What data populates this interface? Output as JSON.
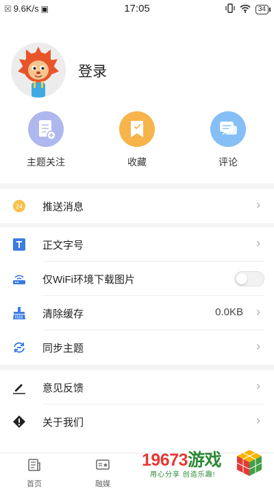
{
  "status_bar": {
    "speed": "9.6K/s",
    "time": "17:05",
    "battery": "34"
  },
  "profile": {
    "login_label": "登录"
  },
  "quick_actions": [
    {
      "label": "主题关注",
      "icon": "topic-follow-icon",
      "color": "#aeb8ee"
    },
    {
      "label": "收藏",
      "icon": "favorite-icon",
      "color": "#f7b44a"
    },
    {
      "label": "评论",
      "icon": "comment-icon",
      "color": "#86bff5"
    }
  ],
  "settings": {
    "push": {
      "label": "推送消息",
      "icon": "push-notification-icon"
    },
    "font_size": {
      "label": "正文字号",
      "icon": "font-size-icon"
    },
    "wifi_images": {
      "label": "仅WiFi环境下载图片",
      "icon": "wifi-router-icon",
      "enabled": false
    },
    "clear_cache": {
      "label": "清除缓存",
      "value": "0.0KB",
      "icon": "broom-icon"
    },
    "sync_topics": {
      "label": "同步主题",
      "icon": "sync-icon"
    },
    "feedback": {
      "label": "意见反馈",
      "icon": "pencil-icon"
    },
    "about": {
      "label": "关于我们",
      "icon": "warning-icon"
    }
  },
  "tabs": [
    {
      "label": "首页",
      "icon": "home-newspaper-icon"
    },
    {
      "label": "融媒",
      "icon": "media-icon"
    }
  ],
  "watermark": {
    "title_digits": "19673",
    "title_cn": "游戏",
    "slogan": "用心分享 创造乐趣!"
  },
  "colors": {
    "accent_blue": "#3b7de0",
    "gap_gray": "#f4f4f4",
    "watermark_red": "#e53935",
    "watermark_green": "#2c8a34"
  }
}
